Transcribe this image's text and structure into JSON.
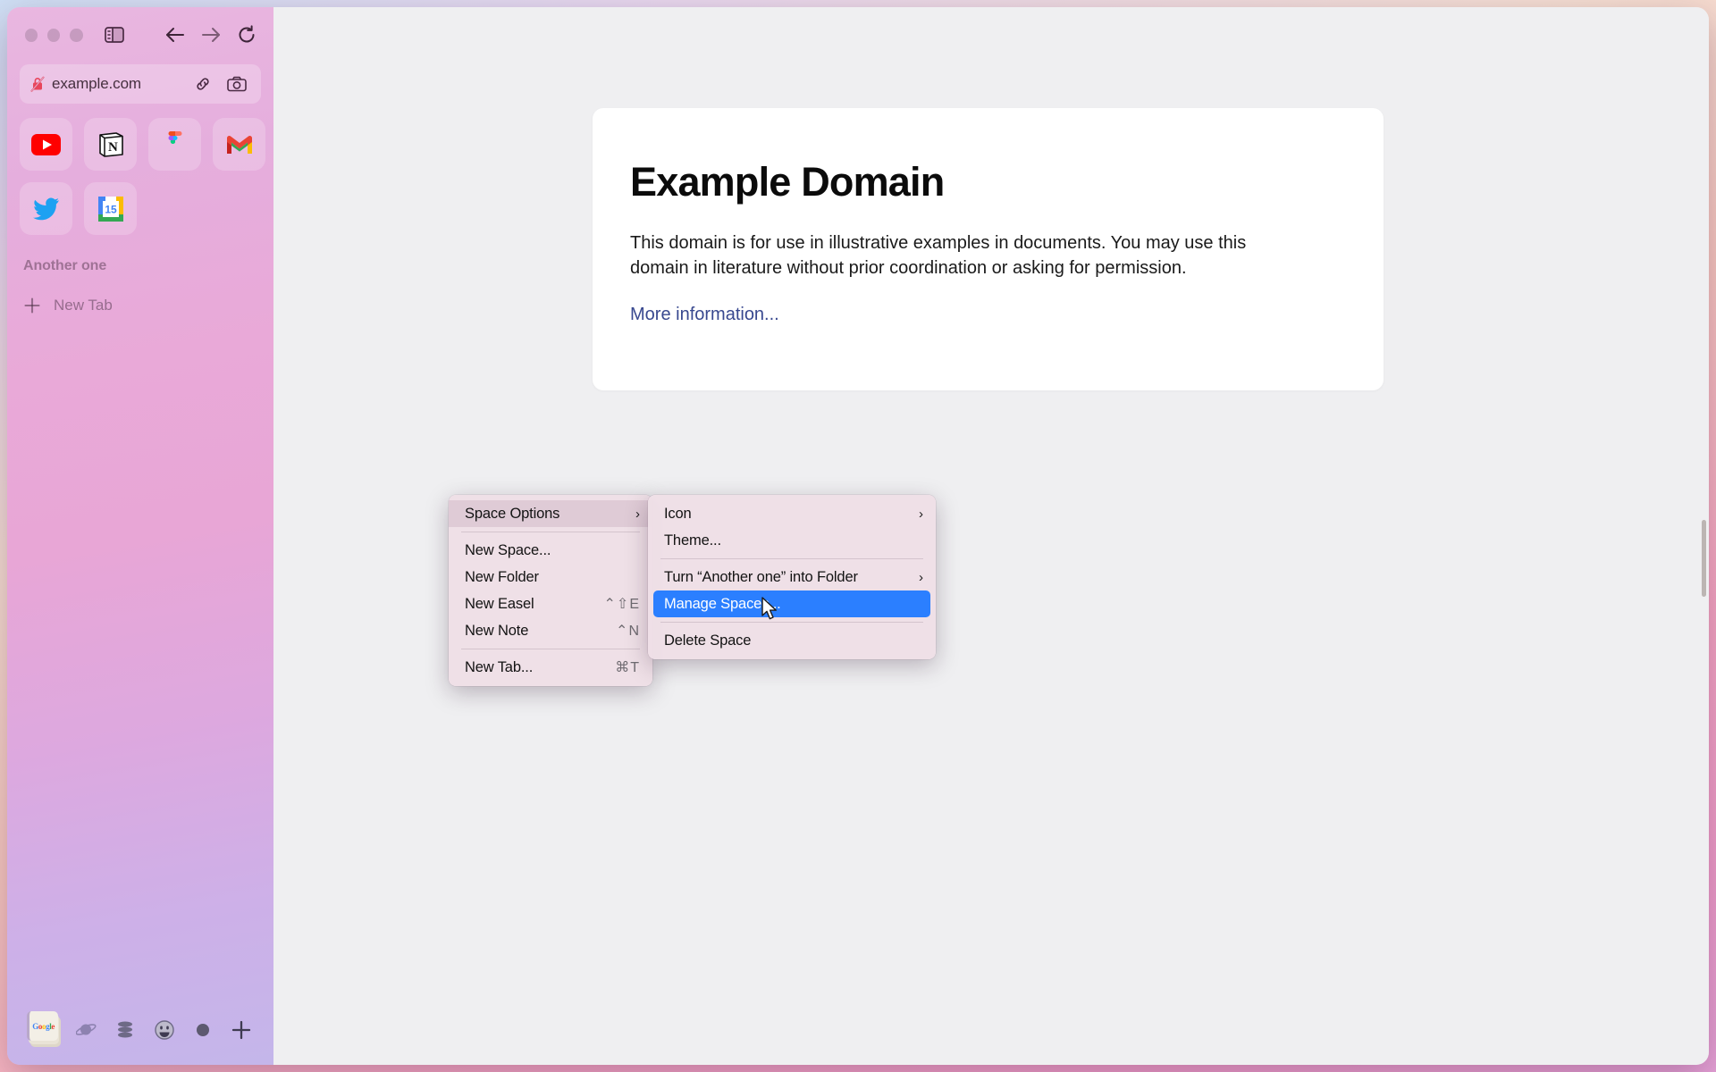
{
  "window": {
    "traffic_lights": [
      "close",
      "minimize",
      "maximize"
    ]
  },
  "toolbar": {
    "sidebar_toggle": "sidebar-toggle-icon",
    "back": "arrow-left-icon",
    "forward": "arrow-right-icon",
    "reload": "reload-icon"
  },
  "url_bar": {
    "security_icon": "lock-slash-insecure-icon",
    "url": "example.com",
    "copy_link_icon": "link-icon",
    "screenshot_icon": "camera-icon"
  },
  "bookmarks": [
    {
      "name": "youtube",
      "label": "YouTube"
    },
    {
      "name": "notion",
      "label": "Notion"
    },
    {
      "name": "figma",
      "label": "Figma"
    },
    {
      "name": "gmail",
      "label": "Gmail"
    },
    {
      "name": "twitter",
      "label": "Twitter"
    },
    {
      "name": "google-calendar",
      "label": "Google Calendar",
      "day": "15"
    }
  ],
  "sidebar": {
    "space_label": "Another one",
    "new_tab_label": "New Tab",
    "new_tab_plus_icon": "plus-icon"
  },
  "bottom_bar": {
    "active_space": "google-space-card",
    "google_wordmark": {
      "g1": "G",
      "o1": "o",
      "o2": "o",
      "g2": "g",
      "l1": "l",
      "e1": "e"
    },
    "spaces": [
      {
        "name": "planet-space",
        "icon": "planet-icon"
      },
      {
        "name": "database-space",
        "icon": "database-icon"
      },
      {
        "name": "smiley-space",
        "icon": "smiley-icon"
      },
      {
        "name": "dot-space",
        "icon": "circle-icon"
      }
    ],
    "add_space_icon": "plus-icon"
  },
  "page": {
    "heading": "Example Domain",
    "paragraph": "This domain is for use in illustrative examples in documents. You may use this domain in literature without prior coordination or asking for permission.",
    "link_text": "More information..."
  },
  "context_menu": {
    "items": [
      {
        "label": "Space Options",
        "shortcut": "",
        "chevron": "›",
        "state": "hover"
      },
      {
        "type": "separator"
      },
      {
        "label": "New Space...",
        "shortcut": ""
      },
      {
        "label": "New Folder",
        "shortcut": ""
      },
      {
        "label": "New Easel",
        "shortcut": "⌃⇧E"
      },
      {
        "label": "New Note",
        "shortcut": "⌃N"
      },
      {
        "type": "separator"
      },
      {
        "label": "New Tab...",
        "shortcut": "⌘T"
      }
    ]
  },
  "submenu": {
    "items": [
      {
        "label": "Icon",
        "chevron": "›"
      },
      {
        "label": "Theme...",
        "chevron": ""
      },
      {
        "type": "separator"
      },
      {
        "label": "Turn “Another one” into Folder",
        "chevron": "›"
      },
      {
        "label": "Manage Spaces...",
        "chevron": "",
        "state": "selected"
      },
      {
        "type": "separator"
      },
      {
        "label": "Delete Space",
        "chevron": ""
      }
    ]
  },
  "colors": {
    "selection_blue": "#2b7fff",
    "link_blue": "#38488f",
    "menu_bg": "#eedfe6",
    "content_bg": "#efeff1"
  }
}
